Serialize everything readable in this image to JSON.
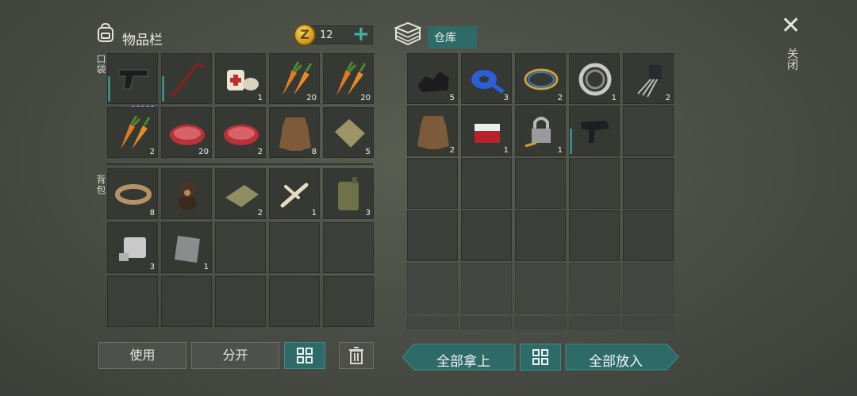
{
  "inventory": {
    "title": "物品栏",
    "coins": "12",
    "pocket_label": "口袋",
    "backpack_label": "背包",
    "pocket_slots": [
      {
        "item": "pistol",
        "count": "",
        "durability": true,
        "dots": "purple"
      },
      {
        "item": "crowbar",
        "count": "",
        "durability": true
      },
      {
        "item": "bandage-medkit",
        "count": "1"
      },
      {
        "item": "carrots",
        "count": "20"
      },
      {
        "item": "carrots",
        "count": "20"
      },
      {
        "item": "carrots",
        "count": "2"
      },
      {
        "item": "raw-meat",
        "count": "20"
      },
      {
        "item": "raw-meat",
        "count": "2"
      },
      {
        "item": "animal-hide",
        "count": "8"
      },
      {
        "item": "cloth",
        "count": "5"
      }
    ],
    "backpack_slots": [
      {
        "item": "rope",
        "count": "8"
      },
      {
        "item": "puppy",
        "count": ""
      },
      {
        "item": "cloth-scrap",
        "count": "2"
      },
      {
        "item": "bones",
        "count": "1"
      },
      {
        "item": "jerrycan",
        "count": "3"
      },
      {
        "item": "engine-part",
        "count": "3"
      },
      {
        "item": "metal-plate",
        "count": "1"
      }
    ]
  },
  "warehouse": {
    "title": "仓库",
    "slots": [
      {
        "item": "coal",
        "count": "5"
      },
      {
        "item": "blue-tape",
        "count": "3"
      },
      {
        "item": "wires",
        "count": "2"
      },
      {
        "item": "bearing",
        "count": "1"
      },
      {
        "item": "transistor",
        "count": "2"
      },
      {
        "item": "animal-hide",
        "count": "2"
      },
      {
        "item": "cigarette-pack",
        "count": "1"
      },
      {
        "item": "padlock-key",
        "count": "1"
      },
      {
        "item": "uzi",
        "count": "",
        "durability": true,
        "dots": "gray"
      }
    ]
  },
  "buttons": {
    "use": "使用",
    "split": "分开",
    "take_all": "全部拿上",
    "put_all": "全部放入",
    "close": "关闭"
  },
  "icons": {
    "backpack": "backpack-icon",
    "coin": "coin-icon",
    "plus": "plus-icon",
    "warehouse": "crate-icon",
    "sort": "sort-grid-icon",
    "trash": "trash-icon",
    "close": "close-icon"
  },
  "colors": {
    "accent_teal": "#2e6a68",
    "plus_teal": "#3fb5a6",
    "coin_gold": "#e0b43a"
  }
}
